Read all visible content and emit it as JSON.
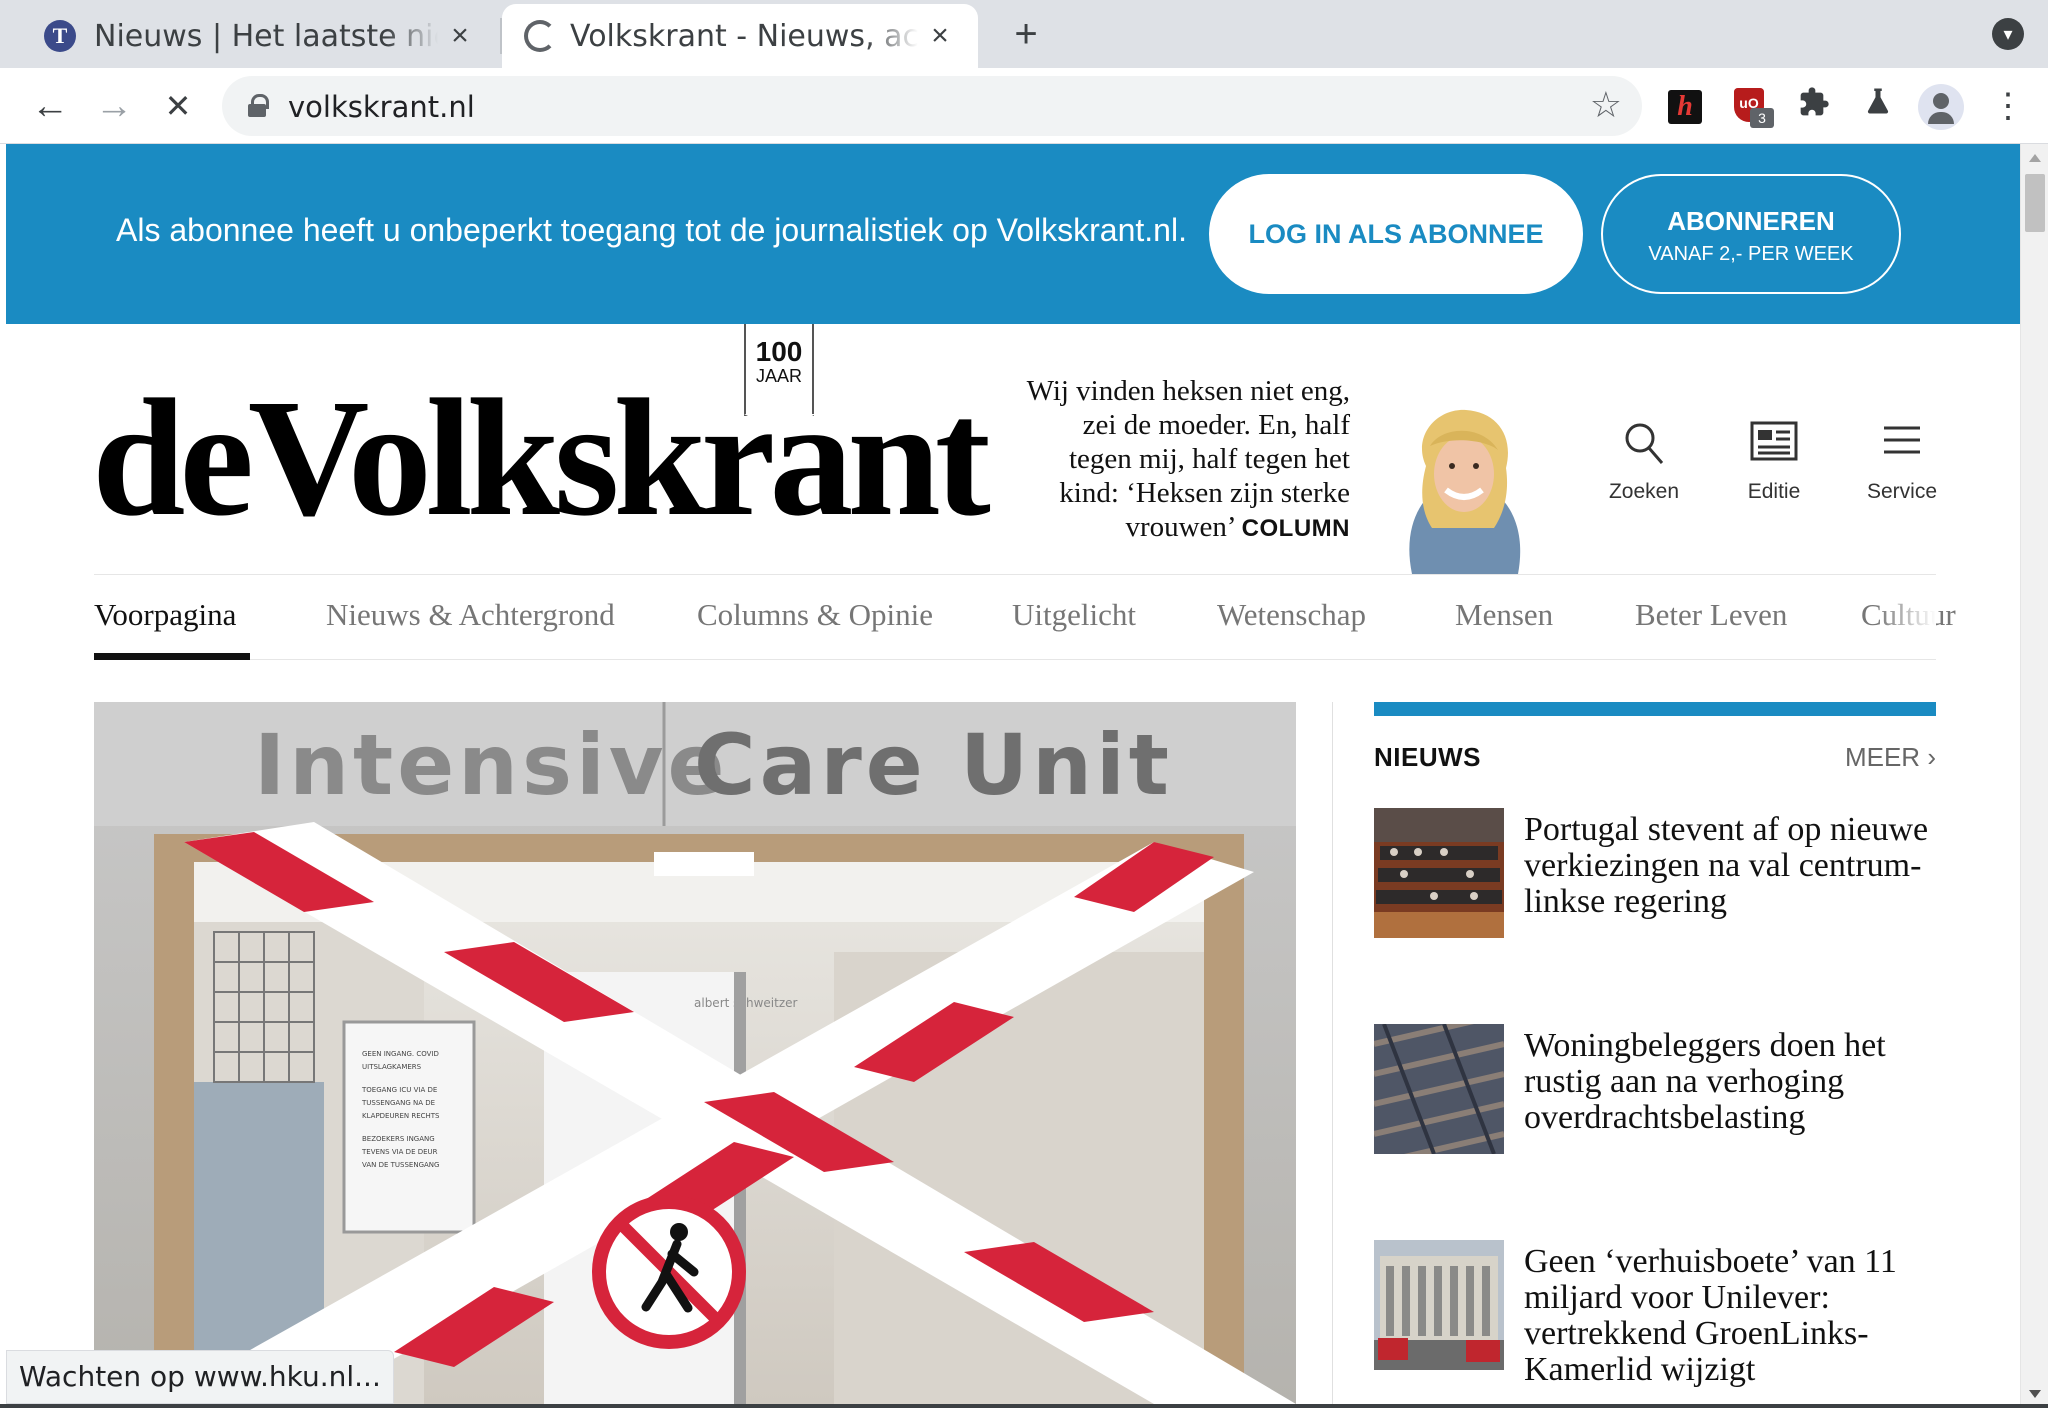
{
  "browser": {
    "tabs": [
      {
        "title": "Nieuws | Het laatste nieuws uit Nederland",
        "active": false,
        "favicon": "telegraaf-favicon"
      },
      {
        "title": "Volkskrant - Nieuws, achtergronden",
        "active": true,
        "favicon": "loading-spinner"
      }
    ],
    "close_glyph": "×",
    "new_tab_glyph": "+",
    "url": "volkskrant.nl",
    "star_glyph": "☆",
    "back_glyph": "←",
    "forward_glyph": "→",
    "stop_glyph": "✕",
    "menu_glyph": "⋮",
    "extensions": {
      "h_label": "h",
      "ublock_label": "uO",
      "ublock_count": "3"
    },
    "status_text": "Wachten op www.hku.nl..."
  },
  "banner": {
    "message": "Als abonnee heeft u onbeperkt toegang tot de journalistiek op Volkskrant.nl.",
    "login_label": "LOG IN ALS ABONNEE",
    "subscribe_label": "ABONNEREN",
    "subscribe_sub": "VANAF 2,- PER WEEK",
    "color": "#1a8bc2"
  },
  "masthead": {
    "logo_text": "deVolkskrant",
    "jaar_number": "100",
    "jaar_label": "JAAR",
    "quote": "Wij vinden heksen niet eng, zei de moeder. En, half tegen mij, half tegen het kind: ‘Heksen zijn sterke vrouwen’",
    "quote_tag": "COLUMN",
    "icons": [
      {
        "label": "Zoeken",
        "icon": "search-icon"
      },
      {
        "label": "Editie",
        "icon": "newspaper-icon"
      },
      {
        "label": "Service",
        "icon": "menu-icon"
      }
    ]
  },
  "nav": {
    "items": [
      "Voorpagina",
      "Nieuws & Achtergrond",
      "Columns & Opinie",
      "Uitgelicht",
      "Wetenschap",
      "Mensen",
      "Beter Leven",
      "Cultuur"
    ],
    "active": "Voorpagina"
  },
  "hero": {
    "sign_text_1": "Intensive",
    "sign_text_2": "Care Unit",
    "notice_lines": [
      "GEEN INGANG. COVID",
      "UITSLAGKAMERS",
      "TOEGANG ICU VIA DE",
      "TUSSENGANG NA DE",
      "KLAPDEUREN RECHTS",
      "BEZOEKERS INGANG",
      "TEVENS VIA DE DEUR",
      "VAN DE TUSSENGANG"
    ],
    "door_label": "albert schweitzer"
  },
  "sidebar": {
    "heading": "NIEUWS",
    "more": "MEER",
    "more_glyph": "›",
    "items": [
      {
        "headline": "Portugal stevent af op nieuwe verkiezingen na val centrum-linkse regering"
      },
      {
        "headline": "Woningbeleggers doen het rustig aan na verhoging overdrachtsbelasting"
      },
      {
        "headline": "Geen ‘verhuisboete’ van 11 miljard voor Unilever: vertrekkend GroenLinks-Kamerlid wijzigt"
      }
    ]
  }
}
